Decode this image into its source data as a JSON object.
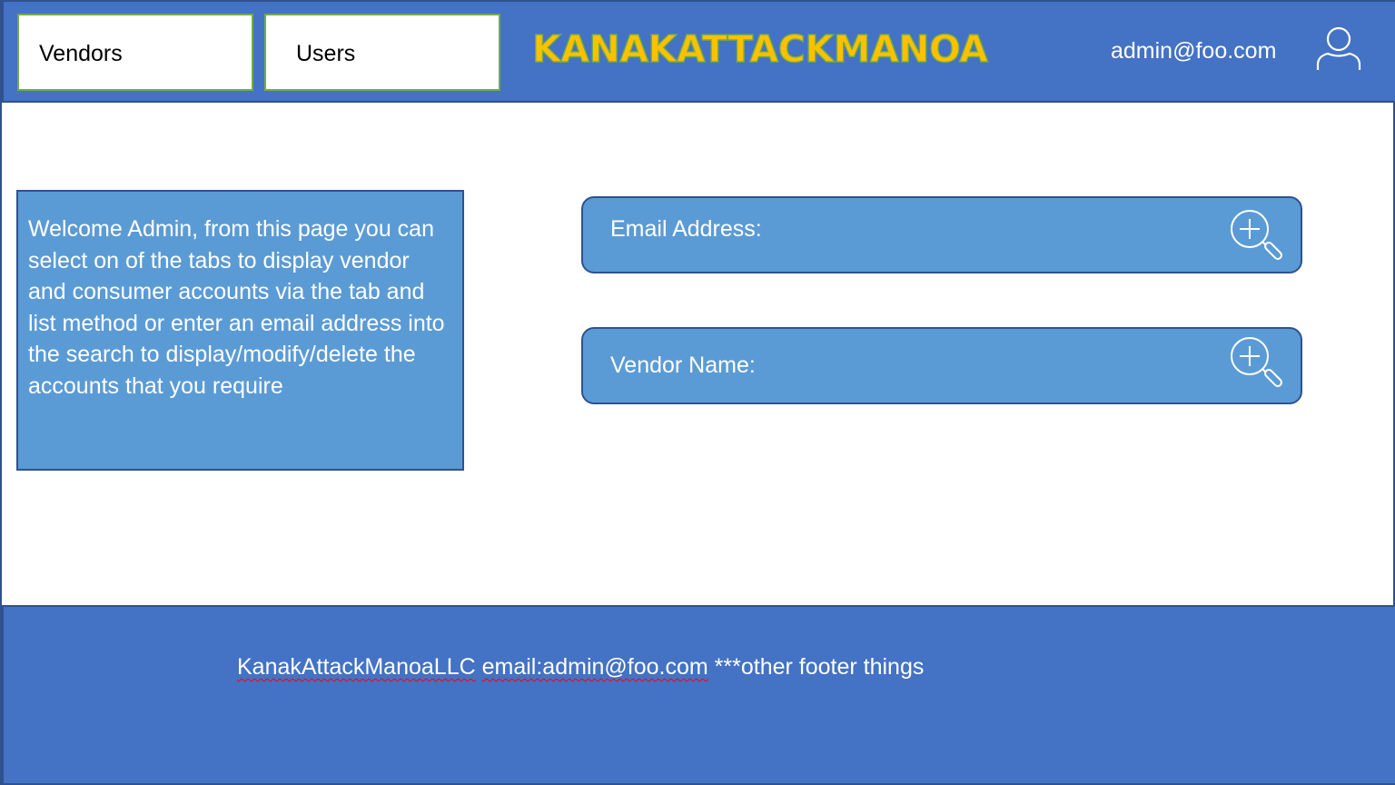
{
  "header": {
    "tabs": [
      {
        "label": "Vendors"
      },
      {
        "label": "Users"
      }
    ],
    "brand": "KANAKATTACKMANOA",
    "user_email": "admin@foo.com",
    "avatar_icon": "user-icon"
  },
  "welcome": {
    "text": "Welcome Admin, from this page you can select on of the tabs to display vendor and consumer accounts via the tab and list method or enter an email address into the search to display/modify/delete the accounts that you require"
  },
  "search": {
    "email": {
      "label": "Email Address:",
      "value": "",
      "icon": "zoom-in-icon"
    },
    "vendor": {
      "label": "Vendor Name:",
      "value": "",
      "icon": "zoom-in-icon"
    }
  },
  "footer": {
    "company": "KanakAttackManoaLLC",
    "email": "email:admin@foo.com",
    "rest": " ***other footer things"
  },
  "colors": {
    "header_bg": "#4472c4",
    "panel_bg": "#5b9bd5",
    "border": "#2f528f",
    "tab_border": "#70ad47",
    "brand_fill": "#ffc000",
    "brand_outline": "#70ad47"
  }
}
